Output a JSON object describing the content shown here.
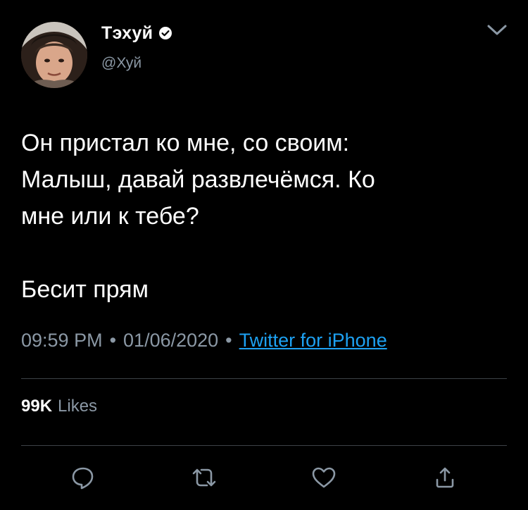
{
  "user": {
    "display_name": "Тэхуй",
    "handle": "@Хуй",
    "verified": true
  },
  "tweet": {
    "text": "Он пристал ко мне, со своим:\nМалыш, давай развлечёмся. Ко\nмне или к тебе?\n\nБесит прям",
    "time": "09:59 PM",
    "separator": "•",
    "date": "01/06/2020",
    "source": "Twitter for iPhone"
  },
  "stats": {
    "likes_count": "99K",
    "likes_label": "Likes"
  },
  "icons": {
    "menu": "chevron-down-icon",
    "verified": "verified-badge-icon",
    "reply": "reply-icon",
    "retweet": "retweet-icon",
    "like": "heart-icon",
    "share": "share-icon"
  },
  "colors": {
    "background": "#000000",
    "text_primary": "#ffffff",
    "text_secondary": "#8b98a5",
    "link": "#1da1f2",
    "divider": "#3d4247"
  }
}
